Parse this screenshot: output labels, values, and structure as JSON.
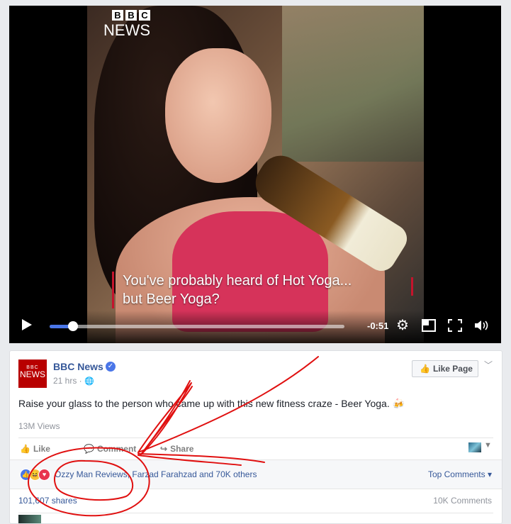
{
  "video": {
    "logo_top": [
      "B",
      "B",
      "C"
    ],
    "logo_bottom": "NEWS",
    "caption_line1": "You've probably heard of Hot Yoga...",
    "caption_line2": "but Beer Yoga?",
    "time_remaining": "-0:51",
    "progress": 0.08,
    "icons": [
      "play-icon",
      "settings-icon",
      "pip-icon",
      "fullscreen-icon",
      "volume-icon"
    ]
  },
  "post": {
    "avatar_top": "BBC",
    "avatar_bottom": "NEWS",
    "page_name": "BBC News",
    "time": "21 hrs ·",
    "like_page_label": "Like Page",
    "text": "Raise your glass to the person who came up with this new fitness craze - Beer Yoga. 🍻",
    "views": "13M Views",
    "actions": {
      "like": "Like",
      "comment": "Comment",
      "share": "Share"
    },
    "reactions_text": "Ozzy Man Reviews, Farzad Farahzad and 70K others",
    "top_comments": "Top Comments ▾",
    "shares": "101,607 shares",
    "comments": "10K Comments"
  },
  "colors": {
    "link": "#365899",
    "accent": "#4a76e8",
    "annotation": "#e01010",
    "bbc_red": "#b80000"
  }
}
